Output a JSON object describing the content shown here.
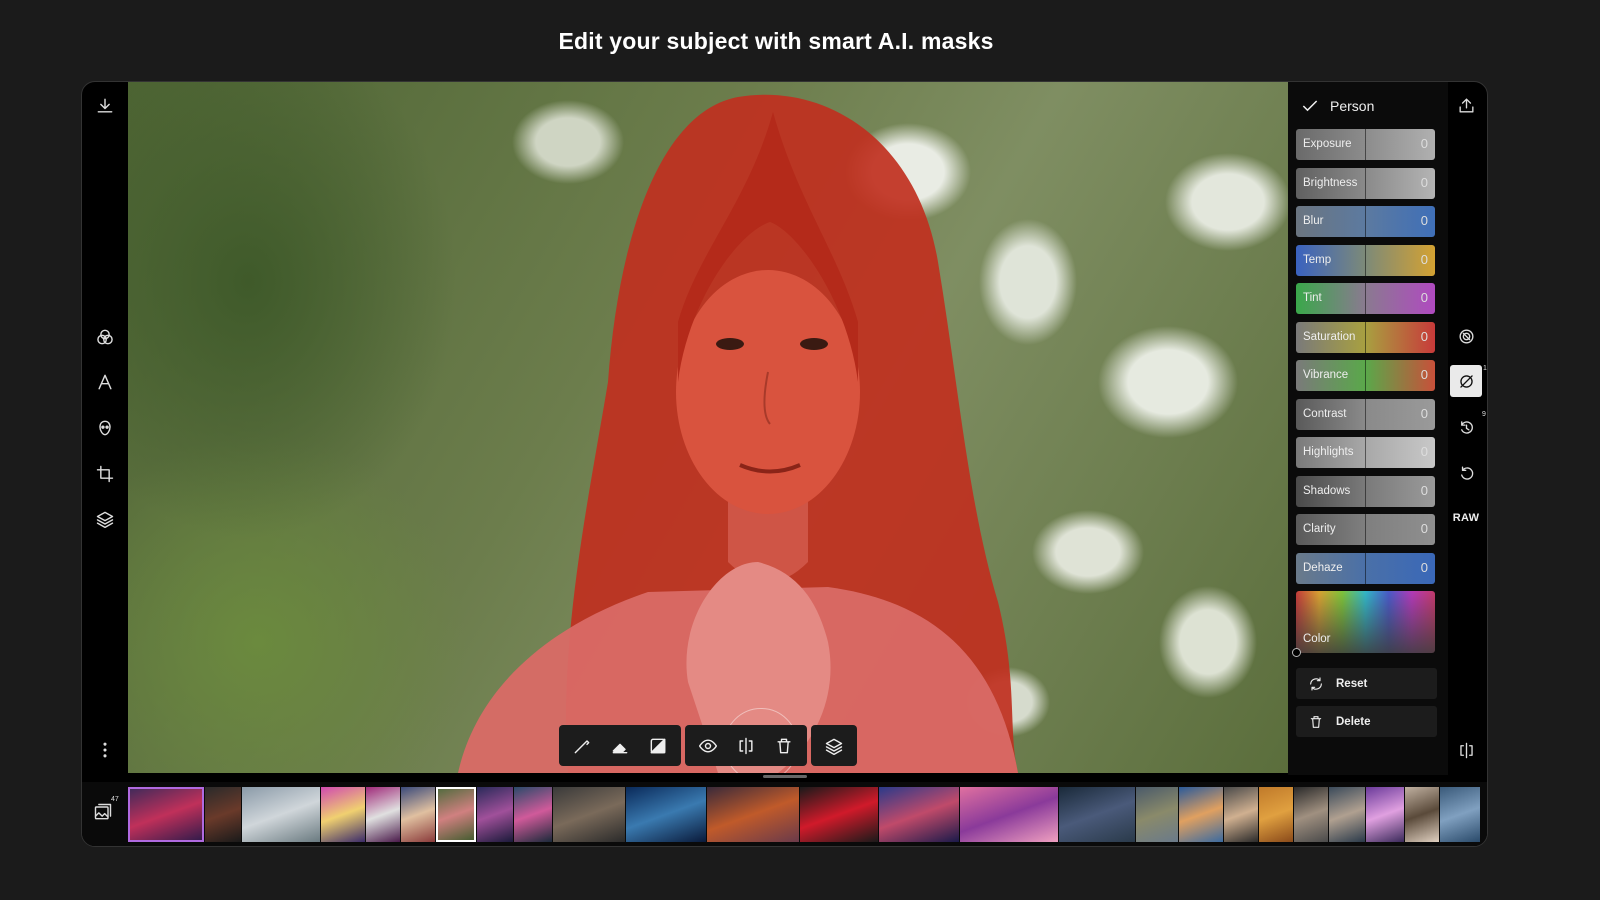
{
  "headline": "Edit your subject with smart A.I. masks",
  "panel": {
    "title": "Person",
    "sliders": [
      {
        "label": "Exposure",
        "value": "0",
        "colors": [
          "#6a6a6a",
          "#8c8c8c",
          "#b0b0b0"
        ]
      },
      {
        "label": "Brightness",
        "value": "0",
        "colors": [
          "#606060",
          "#8a8a8a",
          "#b4b4b4"
        ]
      },
      {
        "label": "Blur",
        "value": "0",
        "colors": [
          "#6b7580",
          "#5c7aa0",
          "#3f6fb8"
        ]
      },
      {
        "label": "Temp",
        "value": "0",
        "colors": [
          "#3a62c0",
          "#7d8a78",
          "#d4a232"
        ]
      },
      {
        "label": "Tint",
        "value": "0",
        "colors": [
          "#3aa84a",
          "#8a7a90",
          "#b04ac0"
        ]
      },
      {
        "label": "Saturation",
        "value": "0",
        "colors": [
          "#7a7a7a",
          "#a8a040",
          "#c83a3a"
        ]
      },
      {
        "label": "Vibrance",
        "value": "0",
        "colors": [
          "#7a7a7a",
          "#5aa84a",
          "#c8503a"
        ]
      },
      {
        "label": "Contrast",
        "value": "0",
        "colors": [
          "#5a5a5a",
          "#8a8a8a",
          "#9a9a9a"
        ]
      },
      {
        "label": "Highlights",
        "value": "0",
        "colors": [
          "#7a7a7a",
          "#a8a8a8",
          "#c8c8c8"
        ]
      },
      {
        "label": "Shadows",
        "value": "0",
        "colors": [
          "#4a4a4a",
          "#7a7a7a",
          "#9a9a9a"
        ]
      },
      {
        "label": "Clarity",
        "value": "0",
        "colors": [
          "#5a5a5a",
          "#7f7f7f",
          "#8f8f8f"
        ]
      },
      {
        "label": "Dehaze",
        "value": "0",
        "colors": [
          "#6a7a8a",
          "#4a70a8",
          "#3a68b8"
        ]
      }
    ],
    "color_label": "Color",
    "reset_label": "Reset",
    "delete_label": "Delete"
  },
  "right_rail": {
    "raw_label": "RAW",
    "mask_badge": "1",
    "history_badge": "9"
  },
  "film_strip": {
    "gallery_count": "47",
    "thumbs": [
      {
        "colors": [
          "#3a2a5a",
          "#c0305a",
          "#2a1a4a"
        ],
        "type": "first"
      },
      {
        "colors": [
          "#2a2a2a",
          "#6a3a2a",
          "#1a1a1a"
        ]
      },
      {
        "colors": [
          "#8a9aa8",
          "#d0d6da",
          "#6a7a80"
        ]
      },
      {
        "colors": [
          "#d04ab0",
          "#f0d070",
          "#3a2a6a"
        ]
      },
      {
        "colors": [
          "#a02a7a",
          "#e0e0e0",
          "#4a1a4a"
        ]
      },
      {
        "colors": [
          "#3a4a7a",
          "#e0c0a0",
          "#8a3a3a"
        ]
      },
      {
        "colors": [
          "#4a6a3a",
          "#d08080",
          "#3a5a2a"
        ],
        "type": "sel"
      },
      {
        "colors": [
          "#2a2a5a",
          "#a0509a",
          "#1a1a3a"
        ]
      },
      {
        "colors": [
          "#2a4a6a",
          "#d05a9a",
          "#1a2a3a"
        ]
      },
      {
        "colors": [
          "#3a3a3a",
          "#7a6a5a",
          "#2a2a2a"
        ]
      },
      {
        "colors": [
          "#0a2a5a",
          "#3a7ab0",
          "#0a1a3a"
        ]
      },
      {
        "colors": [
          "#3a2a3a",
          "#c05a2a",
          "#6a3a4a"
        ]
      },
      {
        "colors": [
          "#1a1a1a",
          "#d01a2a",
          "#1a1a1a"
        ]
      },
      {
        "colors": [
          "#2a3a8a",
          "#c04a6a",
          "#1a1a4a"
        ]
      },
      {
        "colors": [
          "#e070a0",
          "#8a3a9a",
          "#f0a0c0"
        ]
      },
      {
        "colors": [
          "#1a2a3a",
          "#4a5a7a",
          "#2a3a4a"
        ]
      },
      {
        "colors": [
          "#4a5a6a",
          "#8a8a6a",
          "#6a7a8a"
        ]
      },
      {
        "colors": [
          "#2a5a9a",
          "#e0a060",
          "#3a6aa0"
        ]
      },
      {
        "colors": [
          "#4a4a4a",
          "#d0b090",
          "#2a2a2a"
        ]
      },
      {
        "colors": [
          "#c07a2a",
          "#e0a040",
          "#8a4a1a"
        ]
      },
      {
        "colors": [
          "#2a2a2a",
          "#a09080",
          "#4a4a4a"
        ]
      },
      {
        "colors": [
          "#3a4a5a",
          "#b0a090",
          "#2a3a4a"
        ]
      },
      {
        "colors": [
          "#6a3a9a",
          "#e0a0e0",
          "#3a2a5a"
        ]
      },
      {
        "colors": [
          "#c0b0a0",
          "#5a4a3a",
          "#e0d0c0"
        ]
      },
      {
        "colors": [
          "#3a5a7a",
          "#80a0c0",
          "#2a4a6a"
        ]
      }
    ]
  }
}
